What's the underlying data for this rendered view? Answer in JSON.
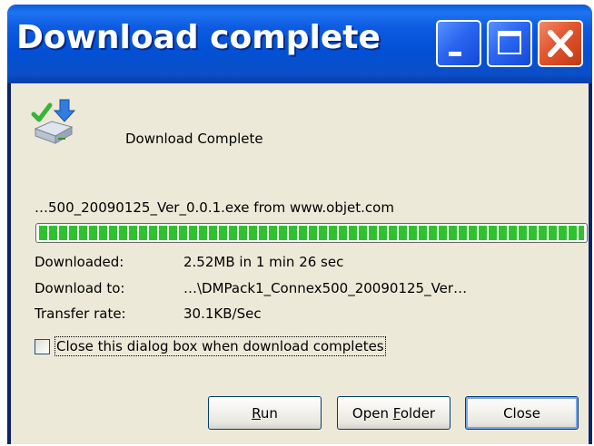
{
  "window": {
    "title": "Download complete"
  },
  "titlebar_buttons": {
    "minimize": "minimize-icon",
    "maximize": "maximize-icon",
    "close": "close-icon"
  },
  "header": {
    "icon": "download-complete-icon",
    "message": "Download Complete"
  },
  "file": {
    "source": "…500_20090125_Ver_0.0.1.exe from www.objet.com"
  },
  "progress": {
    "percent": 100
  },
  "details": [
    {
      "label": "Downloaded:",
      "value": "2.52MB in 1 min 26 sec"
    },
    {
      "label": "Download to:",
      "value": "…\\DMPack1_Connex500_20090125_Ver…"
    },
    {
      "label": "Transfer rate:",
      "value": "30.1KB/Sec"
    }
  ],
  "option": {
    "close_when_complete_label": "Close this dialog box when download completes",
    "checked": false
  },
  "buttons": {
    "run_pre": "",
    "run_accel": "R",
    "run_post": "un",
    "open_pre": "Open ",
    "open_accel": "F",
    "open_post": "older",
    "close_label": "Close"
  },
  "colors": {
    "titlebar": "#0250d4",
    "client_bg": "#ece9d8",
    "progress_fill": "#2fc22f",
    "close_button": "#e2552e"
  }
}
